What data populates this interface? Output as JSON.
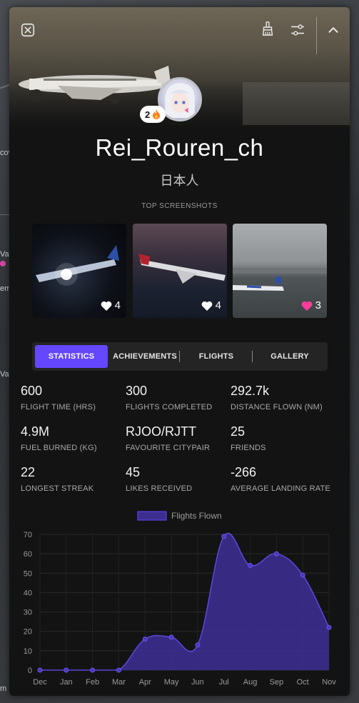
{
  "window": {
    "close_icon": "close-icon",
    "brush_icon": "brush-icon",
    "filter_icon": "sliders-icon",
    "collapse_icon": "chevron-up-icon"
  },
  "background_map": {
    "labels": [
      "cov",
      "Vae",
      "em",
      "Va",
      "m"
    ]
  },
  "profile": {
    "streak_count": "2",
    "streak_icon": "fire-icon",
    "username": "Rei_Rouren_ch",
    "nationality": "日本人"
  },
  "screenshots": {
    "title": "TOP SCREENSHOTS",
    "items": [
      {
        "likes": "4",
        "liked": false
      },
      {
        "likes": "4",
        "liked": false
      },
      {
        "likes": "3",
        "liked": true
      }
    ]
  },
  "tabs": [
    {
      "label": "STATISTICS",
      "active": true
    },
    {
      "label": "ACHIEVEMENTS",
      "active": false
    },
    {
      "label": "FLIGHTS",
      "active": false
    },
    {
      "label": "GALLERY",
      "active": false
    }
  ],
  "stats": [
    {
      "value": "600",
      "label": "FLIGHT TIME (HRS)"
    },
    {
      "value": "300",
      "label": "FLIGHTS COMPLETED"
    },
    {
      "value": "292.7k",
      "label": "DISTANCE FLOWN (NM)"
    },
    {
      "value": "4.9M",
      "label": "FUEL BURNED (KG)"
    },
    {
      "value": "RJOO/RJTT",
      "label": "FAVOURITE CITYPAIR"
    },
    {
      "value": "25",
      "label": "FRIENDS"
    },
    {
      "value": "22",
      "label": "LONGEST STREAK"
    },
    {
      "value": "45",
      "label": "LIKES RECEIVED"
    },
    {
      "value": "-266",
      "label": "AVERAGE LANDING RATE"
    }
  ],
  "colors": {
    "accent": "#6447ff",
    "liked_heart": "#ff3c9c",
    "area_fill": "#3b2e8f",
    "line": "#5b45d8"
  },
  "chart_data": {
    "type": "area",
    "categories": [
      "Dec",
      "Jan",
      "Feb",
      "Mar",
      "Apr",
      "May",
      "Jun",
      "Jul",
      "Aug",
      "Sep",
      "Oct",
      "Nov"
    ],
    "series": [
      {
        "name": "Flights Flown",
        "values": [
          0,
          0,
          0,
          0,
          16,
          17,
          13,
          69,
          54,
          60,
          49,
          22
        ]
      }
    ],
    "ylim": [
      0,
      70
    ],
    "yticks": [
      0,
      10,
      20,
      30,
      40,
      50,
      60,
      70
    ],
    "grid": true,
    "legend": "top-center"
  }
}
